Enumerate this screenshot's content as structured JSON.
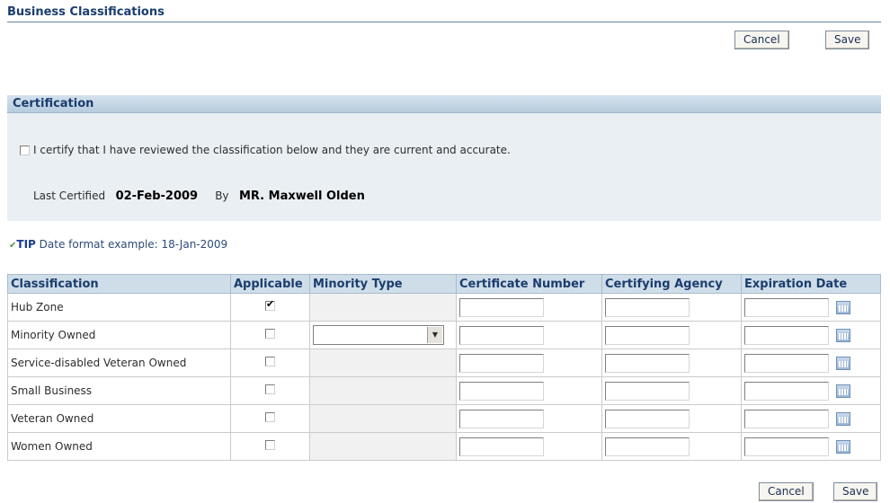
{
  "page": {
    "title": "Business Classifications"
  },
  "buttons": {
    "cancel": "Cancel",
    "save": "Save"
  },
  "certification": {
    "header": "Certification",
    "statement": "I certify that I have reviewed the classification below and they are current and accurate.",
    "certified": false,
    "last_certified_label": "Last Certified",
    "last_certified_date": "02-Feb-2009",
    "by_label": "By",
    "by_name": "MR. Maxwell Olden"
  },
  "tip": {
    "label": "TIP",
    "text": "Date format example: 18-Jan-2009"
  },
  "table": {
    "columns": [
      "Classification",
      "Applicable",
      "Minority Type",
      "Certificate Number",
      "Certifying Agency",
      "Expiration Date"
    ],
    "rows": [
      {
        "classification": "Hub Zone",
        "applicable": true,
        "minority_type_enabled": false
      },
      {
        "classification": "Minority Owned",
        "applicable": false,
        "minority_type_enabled": true,
        "minority_type_value": ""
      },
      {
        "classification": "Service-disabled Veteran Owned",
        "applicable": false,
        "minority_type_enabled": false
      },
      {
        "classification": "Small Business",
        "applicable": false,
        "minority_type_enabled": false
      },
      {
        "classification": "Veteran Owned",
        "applicable": false,
        "minority_type_enabled": false
      },
      {
        "classification": "Women Owned",
        "applicable": false,
        "minority_type_enabled": false
      }
    ]
  },
  "colors": {
    "header_text": "#1a3d6d",
    "section_bg": "#eaeff3",
    "table_header_bg": "#cfdde9"
  }
}
